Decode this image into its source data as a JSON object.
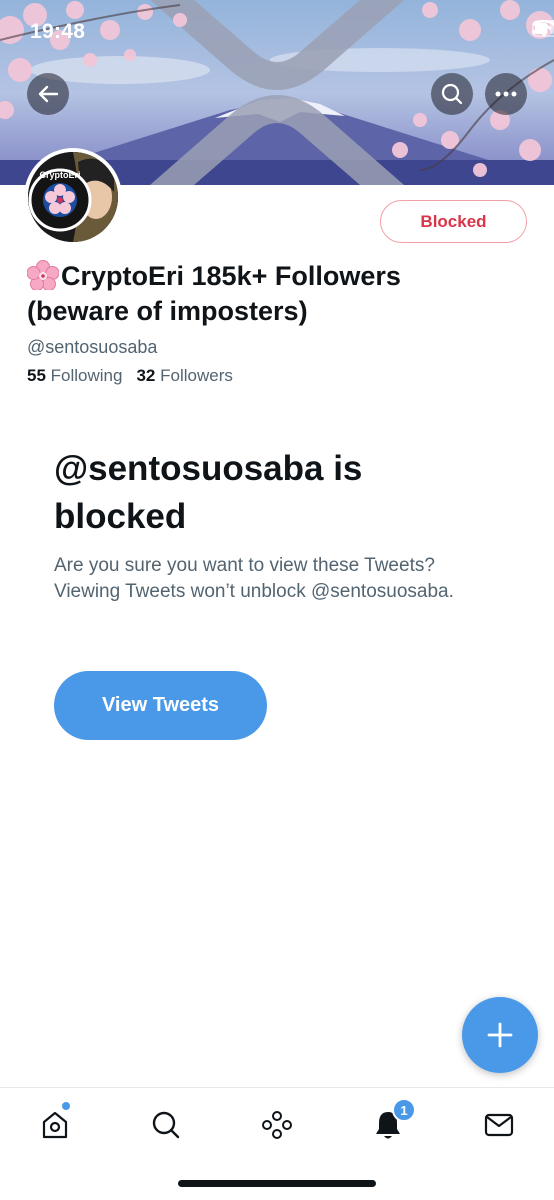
{
  "status_bar": {
    "time": "19:48"
  },
  "profile": {
    "display_name": "CryptoEri 185k+ Followers (beware of imposters)",
    "handle": "@sentosuosaba",
    "following_count": "55",
    "following_label": "Following",
    "followers_count": "32",
    "followers_label": "Followers",
    "blocked_button_label": "Blocked",
    "avatar_text": "CryptoEri"
  },
  "blocked_notice": {
    "title": "@sentosuosaba is blocked",
    "description": "Are you sure you want to view these Tweets? Viewing Tweets won’t unblock @sentosuosaba.",
    "button_label": "View Tweets"
  },
  "tab_bar": {
    "items": [
      "home-icon",
      "search-icon",
      "spaces-icon",
      "notifications-icon",
      "messages-icon"
    ],
    "notification_badge": "1"
  },
  "colors": {
    "accent": "#4a99e9",
    "blocked_red": "#d9364a",
    "secondary_text": "#536471"
  }
}
